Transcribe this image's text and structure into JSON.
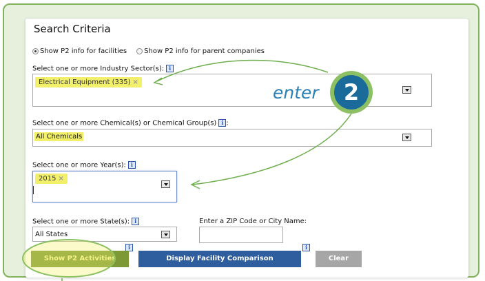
{
  "search": {
    "title": "Search Criteria",
    "radio_facilities": "Show P2 info for facilities",
    "radio_parents": "Show P2 info for parent companies",
    "sector_label": "Select one or more Industry Sector(s):",
    "sector_tag": "Electrical Equipment (335)",
    "chemical_label": "Select one or more Chemical(s) or Chemical Group(s)",
    "chemical_label_suffix": ":",
    "chemical_value": "All Chemicals",
    "year_label": "Select one or more Year(s):",
    "year_tag": "2015",
    "state_label": "Select one or more State(s):",
    "state_value": "All States",
    "zip_label": "Enter a ZIP Code or City Name:",
    "info_glyph": "i",
    "remove_glyph": "×"
  },
  "buttons": {
    "show_p2": "Show P2 Activities",
    "display_comparison": "Display Facility Comparison",
    "clear": "Clear"
  },
  "callout": {
    "text": "enter",
    "step_number": "2"
  },
  "colors": {
    "frame_border": "#7fb25a",
    "frame_bg": "#e6f0dd",
    "highlight_yellow": "#f2f06a",
    "show_button": "#7d9935",
    "comparison_button": "#2f5e9e",
    "clear_button": "#a6a6a6",
    "badge_outer": "#8dc062",
    "badge_inner": "#1b6b9a",
    "arrow": "#6fae4f",
    "enter_text": "#2a7fb4"
  }
}
